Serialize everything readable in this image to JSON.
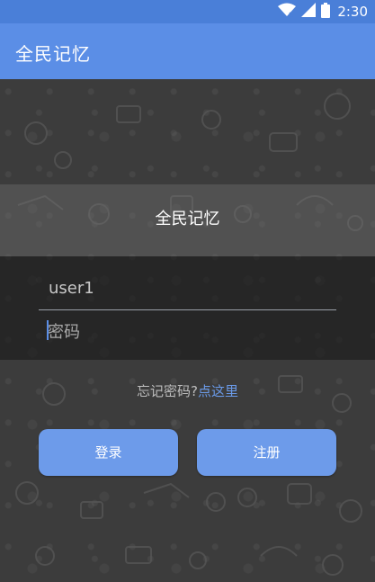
{
  "status_bar": {
    "time": "2:30",
    "icons": [
      "wifi-icon",
      "signal-icon",
      "battery-icon"
    ]
  },
  "app_bar": {
    "title": "全民记忆"
  },
  "login_panel": {
    "title": "全民记忆",
    "username_value": "user1",
    "password_placeholder": "密码"
  },
  "forgot": {
    "text": "忘记密码?",
    "link": "点这里"
  },
  "buttons": {
    "login": "登录",
    "register": "注册"
  },
  "colors": {
    "status_bar": "#4a7fd8",
    "app_bar": "#5b8ee6",
    "button": "#6d9bea",
    "link": "#6a9ae8"
  }
}
